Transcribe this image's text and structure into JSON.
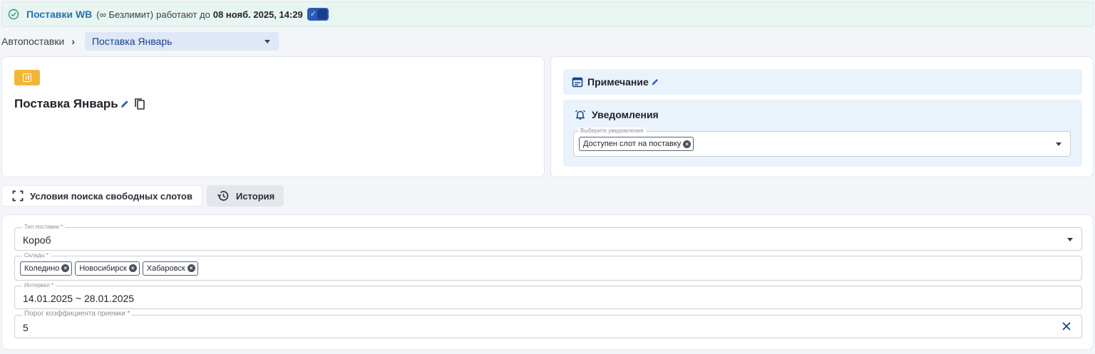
{
  "banner": {
    "service": "Поставки WB",
    "plan": "(∞ Безлимит)",
    "status": "работают до",
    "until": "08 нояб. 2025, 14:29",
    "toggle_on": true,
    "accent": "#2b5bb8"
  },
  "breadcrumb": {
    "root": "Автопоставки",
    "separator": "›",
    "current": "Поставка Январь"
  },
  "supply": {
    "status_icon": "pause-icon",
    "title": "Поставка Январь"
  },
  "note": {
    "label": "Примечание"
  },
  "notifications": {
    "label": "Уведомления",
    "field_label": "Выберите уведомления",
    "chips": [
      "Доступен слот на поставку"
    ]
  },
  "tabs": [
    {
      "label": "Условия поиска свободных слотов",
      "icon": "fullscreen-icon",
      "active": true
    },
    {
      "label": "История",
      "icon": "history-icon",
      "active": false
    }
  ],
  "form": {
    "type": {
      "label": "Тип поставки *",
      "value": "Короб"
    },
    "warehouses": {
      "label": "Склады *",
      "chips": [
        "Коледино",
        "Новосибирск",
        "Хабаровск"
      ]
    },
    "interval": {
      "label": "Интервал *",
      "value": "14.01.2025 ~ 28.01.2025"
    },
    "threshold": {
      "label": "Порог коэффициента приемки *",
      "value": "5"
    }
  }
}
